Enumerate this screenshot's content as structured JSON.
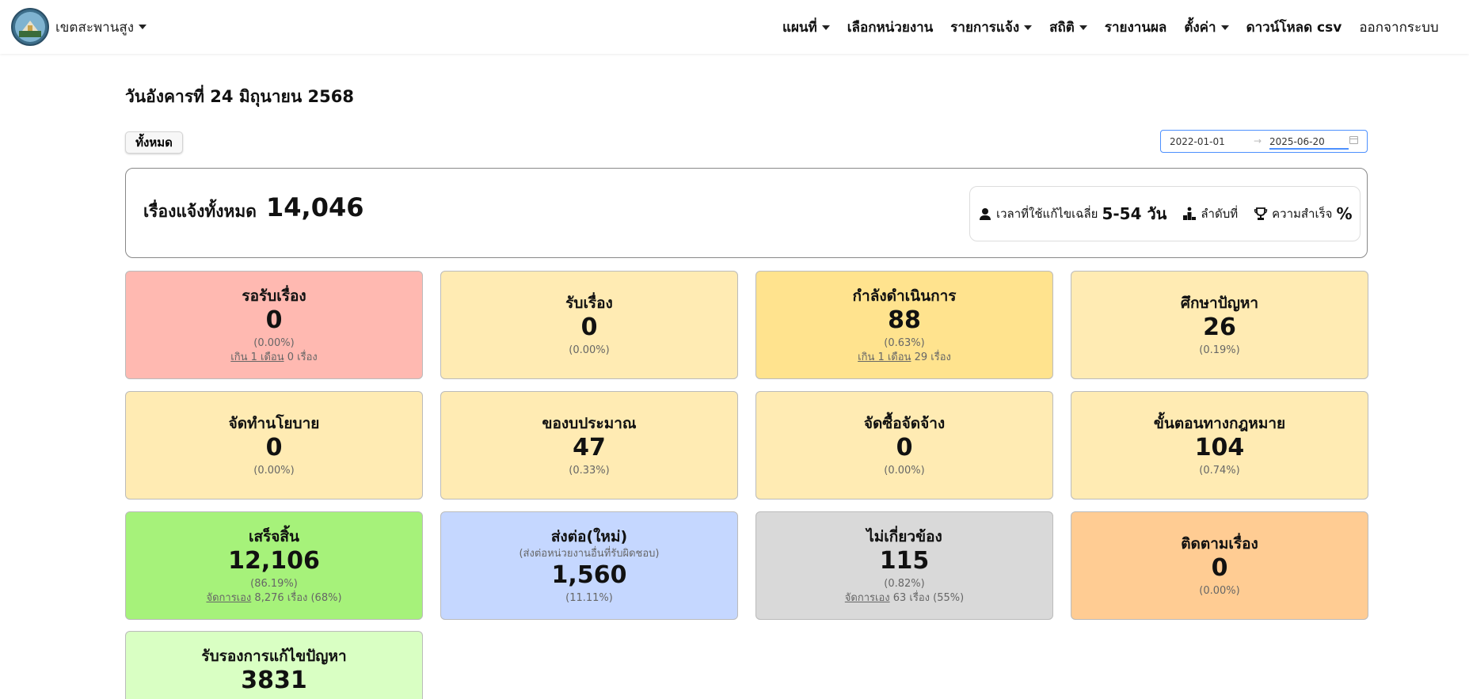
{
  "brand": {
    "name": "เขตสะพานสูง"
  },
  "nav": {
    "items": [
      {
        "label": "แผนที่",
        "dropdown": true
      },
      {
        "label": "เลือกหน่วยงาน",
        "dropdown": false
      },
      {
        "label": "รายการแจ้ง",
        "dropdown": true
      },
      {
        "label": "สถิติ",
        "dropdown": true
      },
      {
        "label": "รายงานผล",
        "dropdown": false
      },
      {
        "label": "ตั้งค่า",
        "dropdown": true
      },
      {
        "label": "ดาวน์โหลด csv",
        "dropdown": false
      }
    ],
    "logout": "ออกจากระบบ"
  },
  "page": {
    "date": "วันอังคารที่ 24 มิถุนายน 2568",
    "all_button": "ทั้งหมด"
  },
  "date_range": {
    "start": "2022-01-01",
    "end": "2025-06-20"
  },
  "summary": {
    "title": "เรื่องแจ้งทั้งหมด",
    "count": "14,046",
    "avg_time_label": "เวลาที่ใช้แก้ไขเฉลี่ย",
    "avg_time_value": "5-54 วัน",
    "rank_label": "ลำดับที่",
    "success_label": "ความสำเร็จ",
    "success_value": "%"
  },
  "cards": {
    "pending": {
      "title": "รอรับเรื่อง",
      "value": "0",
      "percent": "(0.00%)",
      "link": "เกิน 1 เดือน",
      "extra": "0 เรื่อง"
    },
    "received": {
      "title": "รับเรื่อง",
      "value": "0",
      "percent": "(0.00%)"
    },
    "in_progress": {
      "title": "กำลังดำเนินการ",
      "value": "88",
      "percent": "(0.63%)",
      "link": "เกิน 1 เดือน",
      "extra": "29 เรื่อง"
    },
    "study": {
      "title": "ศึกษาปัญหา",
      "value": "26",
      "percent": "(0.19%)"
    },
    "policy": {
      "title": "จัดทำนโยบาย",
      "value": "0",
      "percent": "(0.00%)"
    },
    "budget": {
      "title": "ของบประมาณ",
      "value": "47",
      "percent": "(0.33%)"
    },
    "procurement": {
      "title": "จัดซื้อจัดจ้าง",
      "value": "0",
      "percent": "(0.00%)"
    },
    "legal": {
      "title": "ขั้นตอนทางกฎหมาย",
      "value": "104",
      "percent": "(0.74%)"
    },
    "done": {
      "title": "เสร็จสิ้น",
      "value": "12,106",
      "percent": "(86.19%)",
      "link": "จัดการเอง",
      "extra": "8,276 เรื่อง (68%)"
    },
    "forwarded": {
      "title": "ส่งต่อ(ใหม่)",
      "subtitle": "(ส่งต่อหน่วยงานอื่นที่รับผิดชอบ)",
      "value": "1,560",
      "percent": "(11.11%)"
    },
    "irrelevant": {
      "title": "ไม่เกี่ยวข้อง",
      "value": "115",
      "percent": "(0.82%)",
      "link": "จัดการเอง",
      "extra": "63 เรื่อง (55%)"
    },
    "follow_up": {
      "title": "ติดตามเรื่อง",
      "value": "0",
      "percent": "(0.00%)"
    },
    "certified": {
      "title": "รับรองการแก้ไขปัญหา",
      "value": "3831"
    }
  },
  "colors": {
    "pending": "#ffb9b1",
    "yellow": "#ffebb3",
    "in_progress": "#ffe38e",
    "done": "#a6f27a",
    "forwarded": "#c5d7ff",
    "irrelevant": "#d9d9d9",
    "follow_up": "#ffcc93",
    "certified": "#d9ffc3",
    "accent": "#4d90fe"
  },
  "icons": {
    "avg_time": "user-clock-icon",
    "rank": "ranking-icon",
    "success": "trophy-icon",
    "calendar": "calendar-icon"
  }
}
